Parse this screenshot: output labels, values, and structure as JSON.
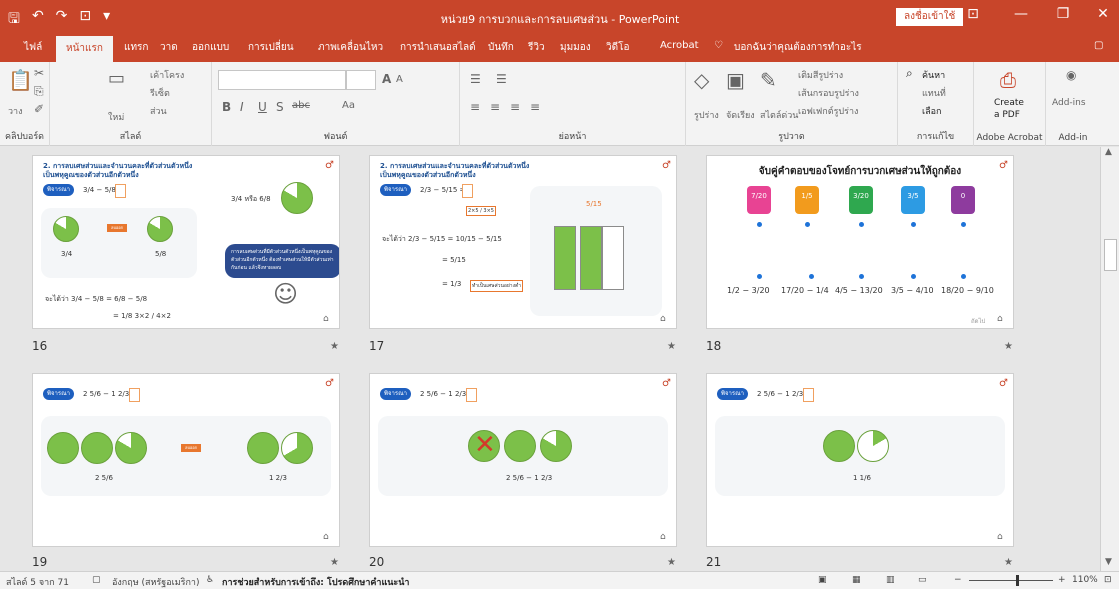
{
  "window": {
    "title": "หน่วย9 การบวกและการลบเศษส่วน - PowerPoint",
    "signin_label": "ลงชื่อเข้าใช้",
    "controls": {
      "minimize": "—",
      "restore": "❐",
      "close": "✕",
      "display": "⊡"
    }
  },
  "qat": {
    "save": "🖫",
    "undo": "↶",
    "redo": "↷",
    "present": "⊡",
    "more": "▾"
  },
  "tabs": {
    "file": "ไฟล์",
    "home": "หน้าแรก",
    "insert": "แทรก",
    "draw": "วาด",
    "design": "ออกแบบ",
    "transitions": "การเปลี่ยน",
    "animations": "ภาพเคลื่อนไหว",
    "slideshow": "การนำเสนอสไลด์",
    "record": "บันทึก",
    "review": "รีวิว",
    "view": "มุมมอง",
    "video": "วิดีโอ",
    "acrobat": "Acrobat",
    "tellme": "บอกฉันว่าคุณต้องการทำอะไร",
    "comments": "▢"
  },
  "ribbon": {
    "clipboard": {
      "label": "คลิปบอร์ด",
      "paste": "วาง"
    },
    "slides": {
      "label": "สไลด์",
      "new_slide": "ใหม่",
      "layout": "เค้าโครง",
      "reset": "รีเซ็ต",
      "section": "ส่วน"
    },
    "font": {
      "label": "ฟอนต์",
      "bold": "B",
      "italic": "I",
      "underline": "U",
      "shadow": "S",
      "strike": "abc",
      "grow": "A",
      "shrink": "A",
      "case": "Aa"
    },
    "paragraph": {
      "label": "ย่อหน้า"
    },
    "drawing": {
      "label": "รูปวาด",
      "shapes": "รูปร่าง",
      "arrange": "จัดเรียง",
      "quick_styles": "สไตล์ด่วน",
      "fill": "เติมสีรูปร่าง",
      "outline": "เส้นกรอบรูปร่าง",
      "effects": "เอฟเฟกต์รูปร่าง"
    },
    "editing": {
      "label": "การแก้ไข",
      "find": "ค้นหา",
      "replace": "แทนที่",
      "select": "เลือก"
    },
    "acrobat": {
      "label": "Adobe Acrobat",
      "create_pdf_line1": "Create",
      "create_pdf_line2": "a PDF"
    },
    "addins": {
      "label": "Add-in",
      "addins_btn": "Add-ins"
    }
  },
  "slides": [
    {
      "number": "16",
      "title_line1": "2. การลบเศษส่วนและจำนวนคละที่ตัวส่วนตัวหนึ่ง",
      "title_line2": "เป็นพหุคูณของตัวส่วนอีกตัวหนึ่ง",
      "badge": "พิจารณา",
      "expr": "3/4 − 5/8 =",
      "f1": "3/4",
      "f2": "5/8",
      "tag": "ลบออก",
      "small_eq": "3/4 หรือ 6/8",
      "bubble": "การลบเศษส่วนที่มีตัวส่วนตัวหนึ่งเป็นพหุคูณของตัวส่วนอีกตัวหนึ่ง ต้องทำเศษส่วนให้มีตัวส่วนเท่ากันก่อน แล้วจึงหาผลลบ",
      "work1": "จะได้ว่า  3/4 − 5/8 = 6/8 − 5/8",
      "work2": "= 1/8   3×2 / 4×2"
    },
    {
      "number": "17",
      "title_line1": "2. การลบเศษส่วนและจำนวนคละที่ตัวส่วนตัวหนึ่ง",
      "title_line2": "เป็นพหุคูณของตัวส่วนอีกตัวหนึ่ง",
      "badge": "พิจารณา",
      "expr": "2/3 − 5/15 =",
      "work1": "จะได้ว่า  2/3 − 5/15 = 10/15 − 5/15",
      "work2": "= 5/15",
      "work3": "= 1/3",
      "note": "ทำเป็นเศษส่วนอย่างต่ำ",
      "bar_label": "5/15",
      "mult": "2×5 / 3×5"
    },
    {
      "number": "18",
      "title": "จับคู่คำตอบของโจทย์การบวกเศษส่วนให้ถูกต้อง",
      "cards": [
        "7/20",
        "1/5",
        "3/20",
        "3/5",
        "0"
      ],
      "problems": [
        "1/2 − 3/20",
        "17/20 − 1/4",
        "4/5 − 13/20",
        "3/5 − 4/10",
        "18/20 − 9/10"
      ],
      "footer": "ถัดไป"
    },
    {
      "number": "19",
      "badge": "พิจารณา",
      "expr": "2 5/6 − 1 2/3 =",
      "left_label": "2 5/6",
      "right_label": "1 2/3",
      "tag": "ลบออก"
    },
    {
      "number": "20",
      "badge": "พิจารณา",
      "expr": "2 5/6 − 1 2/3 =",
      "label": "2 5/6 − 1 2/3"
    },
    {
      "number": "21",
      "badge": "พิจารณา",
      "expr": "2 5/6 − 1 2/3 =",
      "label": "1 1/6"
    }
  ],
  "status": {
    "slide_info": "สไลด์ 5 จาก 71",
    "language": "อังกฤษ (สหรัฐอเมริกา)",
    "accessibility": "การช่วยสำหรับการเข้าถึง: โปรดศึกษาคำแนะนำ",
    "zoom_minus": "−",
    "zoom_plus": "+",
    "zoom": "110%"
  }
}
